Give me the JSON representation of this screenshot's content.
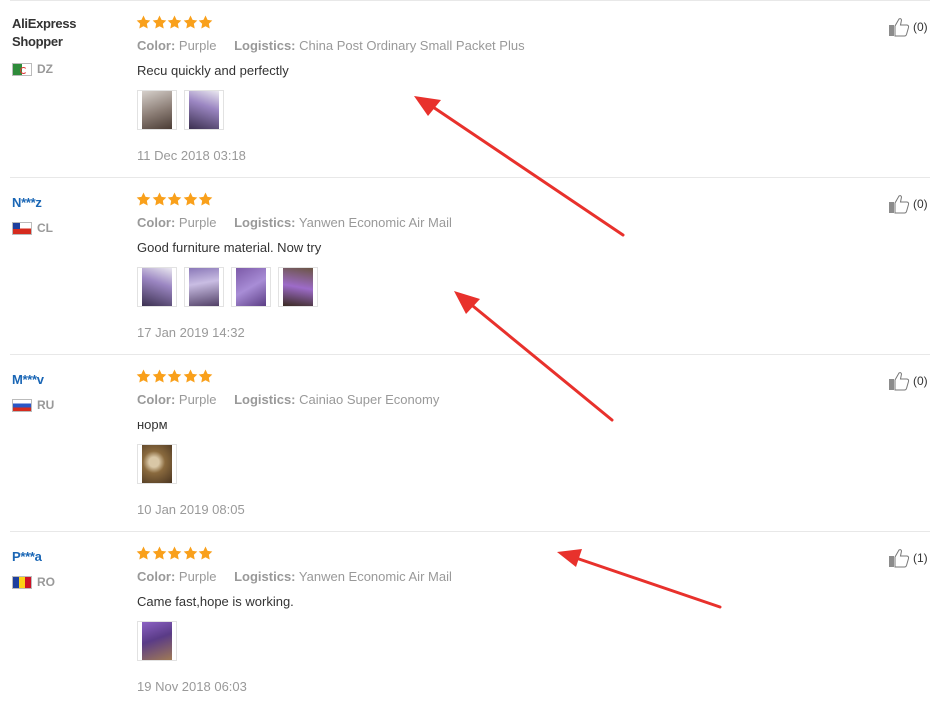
{
  "reviews": [
    {
      "user": "AliExpress Shopper",
      "country_code": "DZ",
      "rating": 5,
      "color_label": "Color:",
      "color_value": "Purple",
      "logistics_label": "Logistics:",
      "logistics_value": "China Post Ordinary Small Packet Plus",
      "text": "Recu quickly and perfectly",
      "photos": [
        "review-photo",
        "review-photo"
      ],
      "date": "11 Dec 2018 03:18",
      "helpful_count": "(0)"
    },
    {
      "user": "N***z",
      "country_code": "CL",
      "rating": 5,
      "color_label": "Color:",
      "color_value": "Purple",
      "logistics_label": "Logistics:",
      "logistics_value": "Yanwen Economic Air Mail",
      "text": "Good furniture material. Now try",
      "photos": [
        "review-photo",
        "review-photo",
        "review-photo",
        "review-photo"
      ],
      "date": "17 Jan 2019 14:32",
      "helpful_count": "(0)"
    },
    {
      "user": "M***v",
      "country_code": "RU",
      "rating": 5,
      "color_label": "Color:",
      "color_value": "Purple",
      "logistics_label": "Logistics:",
      "logistics_value": "Cainiao Super Economy",
      "text": "норм",
      "photos": [
        "review-photo"
      ],
      "date": "10 Jan 2019 08:05",
      "helpful_count": "(0)"
    },
    {
      "user": "P***a",
      "country_code": "RO",
      "rating": 5,
      "color_label": "Color:",
      "color_value": "Purple",
      "logistics_label": "Logistics:",
      "logistics_value": "Yanwen Economic Air Mail",
      "text": "Came fast,hope is working.",
      "photos": [
        "review-photo"
      ],
      "date": "19 Nov 2018 06:03",
      "helpful_count": "(1)"
    }
  ],
  "colors": {
    "star": "#f9a01b",
    "username_link": "#1a66b5",
    "muted": "#999999",
    "annotation_arrow": "#e8312c"
  },
  "icons": {
    "rating": "star-icon",
    "helpful": "thumbs-up-icon"
  }
}
